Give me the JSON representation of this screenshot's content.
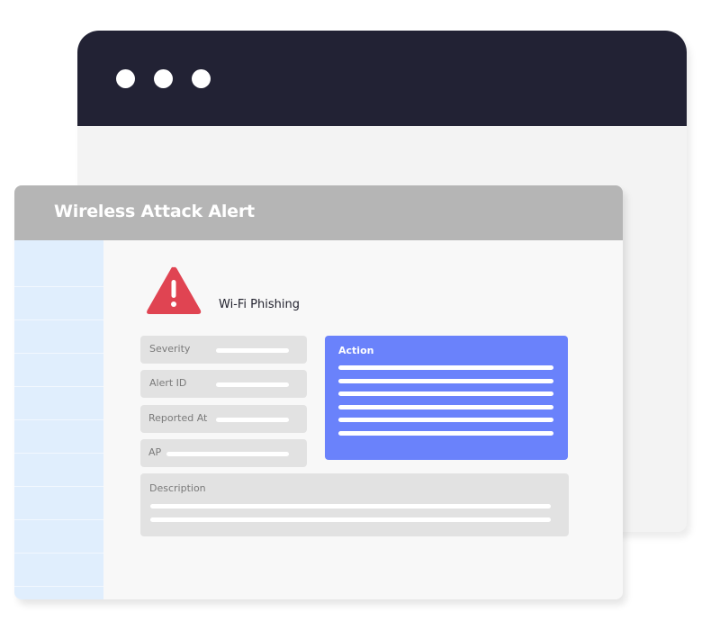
{
  "back_window": {
    "window_controls": [
      "dot",
      "dot",
      "dot"
    ]
  },
  "alert_window": {
    "title": "Wireless Attack Alert",
    "alert_icon": "warning-triangle-icon",
    "alert_type": "Wi-Fi Phishing",
    "fields": [
      {
        "label": "Severity"
      },
      {
        "label": "Alert ID"
      },
      {
        "label": "Reported At"
      },
      {
        "label": "AP"
      }
    ],
    "action": {
      "label": "Action",
      "line_count": 6
    },
    "description": {
      "label": "Description",
      "line_count": 2
    },
    "sidebar_row_count": 11
  },
  "colors": {
    "titlebar": "#222234",
    "header": "#b5b5b5",
    "sidebar": "#e0eefd",
    "warning": "#e04452",
    "action": "#6a82fb",
    "field_bg": "#e2e2e2"
  }
}
